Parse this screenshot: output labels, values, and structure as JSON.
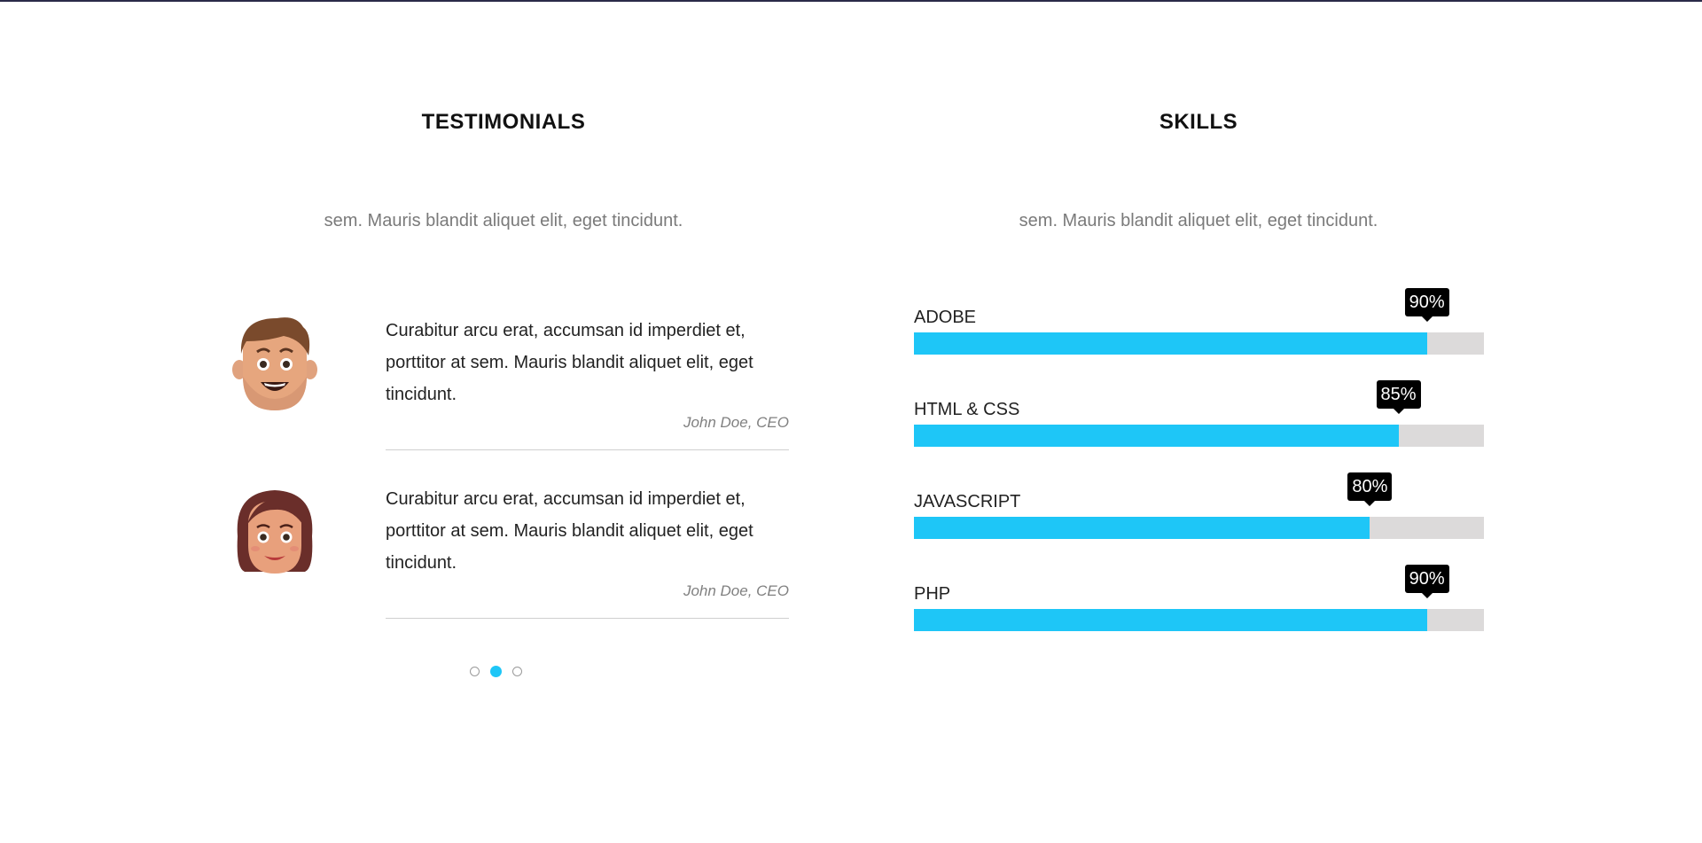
{
  "testimonials": {
    "title": "TESTIMONIALS",
    "subtitle": "sem. Mauris blandit aliquet elit, eget tincidunt.",
    "items": [
      {
        "text": "Curabitur arcu erat, accumsan id imperdiet et, porttitor at sem. Mauris blandit aliquet elit, eget tincidunt.",
        "author": "John Doe, CEO",
        "avatar": "male-avatar-icon"
      },
      {
        "text": "Curabitur arcu erat, accumsan id imperdiet et, porttitor at sem. Mauris blandit aliquet elit, eget tincidunt.",
        "author": "John Doe, CEO",
        "avatar": "female-avatar-icon"
      }
    ],
    "pagination": {
      "count": 3,
      "active_index": 1
    }
  },
  "skills": {
    "title": "SKILLS",
    "subtitle": "sem. Mauris blandit aliquet elit, eget tincidunt.",
    "items": [
      {
        "label": "ADOBE",
        "percent": 90,
        "percent_label": "90%"
      },
      {
        "label": "HTML & CSS",
        "percent": 85,
        "percent_label": "85%"
      },
      {
        "label": "JAVASCRIPT",
        "percent": 80,
        "percent_label": "80%"
      },
      {
        "label": "PHP",
        "percent": 90,
        "percent_label": "90%"
      }
    ]
  },
  "colors": {
    "accent": "#1ec6f7",
    "bar_track": "#dcdada",
    "bubble": "#000000"
  }
}
